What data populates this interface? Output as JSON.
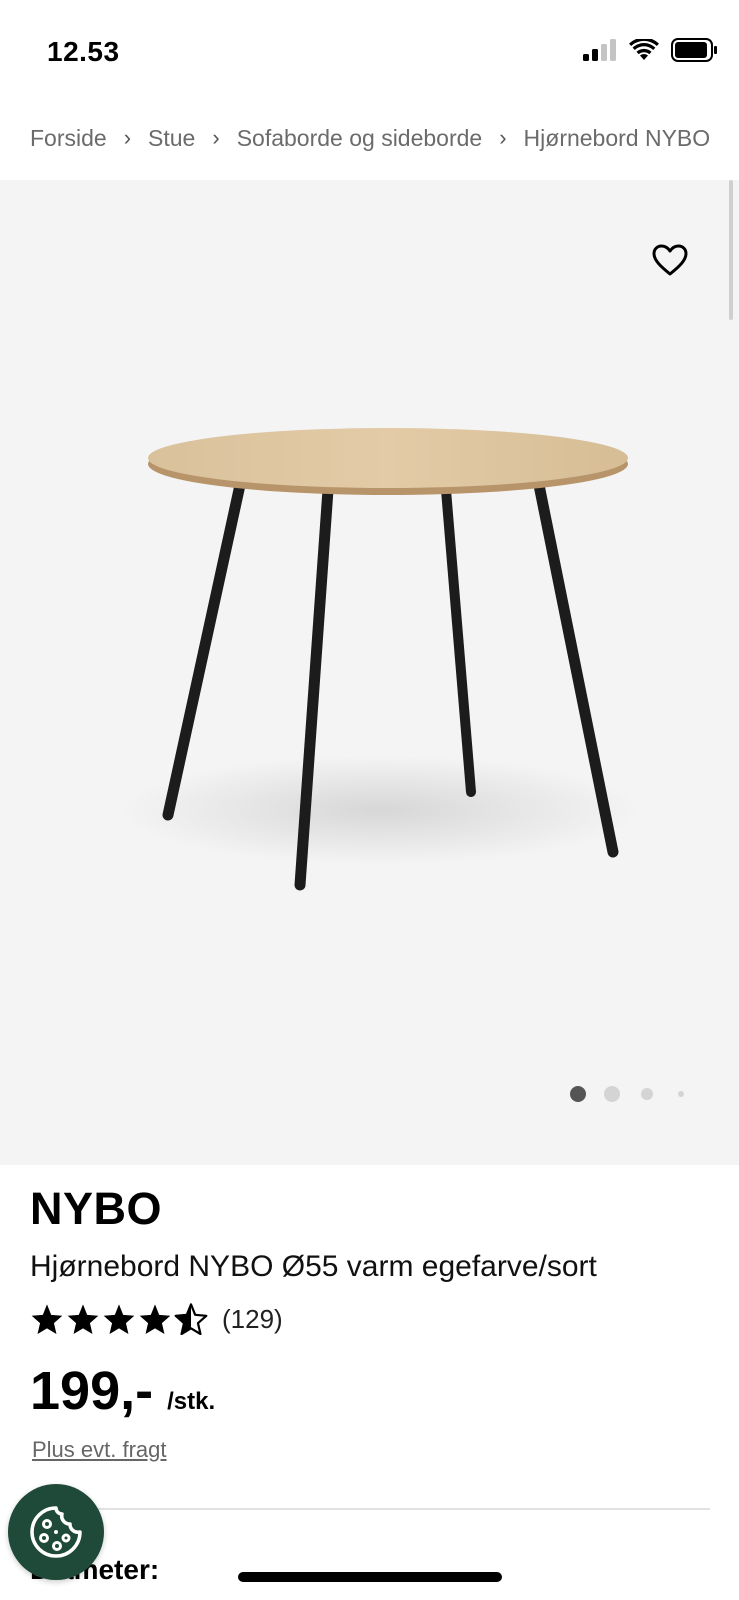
{
  "status_bar": {
    "time": "12.53",
    "signal_icon": "cellular-signal-icon",
    "wifi_icon": "wifi-icon",
    "battery_icon": "battery-icon"
  },
  "breadcrumb": {
    "items": [
      "Forside",
      "Stue",
      "Sofaborde og sideborde",
      "Hjørnebord NYBO"
    ],
    "separator": "›"
  },
  "gallery": {
    "favorite_icon": "heart-icon",
    "image_count": 4,
    "active_index": 0
  },
  "product": {
    "brand": "NYBO",
    "name": "Hjørnebord NYBO Ø55 varm egefarve/sort",
    "rating": 4.5,
    "rating_max": 5,
    "review_count": "(129)",
    "price": "199,-",
    "unit": "/stk.",
    "shipping_note": "Plus evt. fragt",
    "next_section_label": "Diameter:"
  },
  "cookie_button": {
    "icon": "cookie-icon"
  },
  "colors": {
    "gallery_bg": "#f4f4f4",
    "cookie_bg": "#1f4a3a",
    "text": "#111111",
    "muted": "#6b6b6b"
  }
}
